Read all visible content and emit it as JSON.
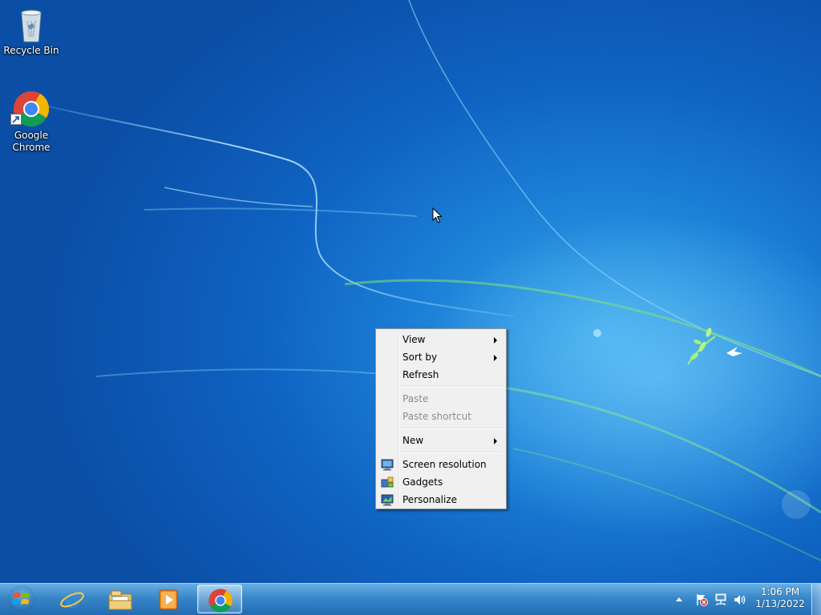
{
  "desktop": {
    "icons": [
      {
        "label": "Recycle Bin",
        "icon": "recycle-bin-icon"
      },
      {
        "label": "Google Chrome",
        "icon": "chrome-icon"
      }
    ]
  },
  "context_menu": {
    "items": [
      {
        "label": "View",
        "submenu": true,
        "enabled": true
      },
      {
        "label": "Sort by",
        "submenu": true,
        "enabled": true
      },
      {
        "label": "Refresh",
        "submenu": false,
        "enabled": true
      },
      {
        "label": "Paste",
        "submenu": false,
        "enabled": false
      },
      {
        "label": "Paste shortcut",
        "submenu": false,
        "enabled": false
      },
      {
        "label": "New",
        "submenu": true,
        "enabled": true
      },
      {
        "label": "Screen resolution",
        "submenu": false,
        "enabled": true,
        "icon": "screen-resolution-icon"
      },
      {
        "label": "Gadgets",
        "submenu": false,
        "enabled": true,
        "icon": "gadgets-icon"
      },
      {
        "label": "Personalize",
        "submenu": false,
        "enabled": true,
        "icon": "personalize-icon"
      }
    ]
  },
  "taskbar": {
    "pinned": [
      {
        "icon": "internet-explorer-icon"
      },
      {
        "icon": "windows-explorer-icon"
      },
      {
        "icon": "media-player-icon"
      },
      {
        "icon": "chrome-icon",
        "active": true
      }
    ],
    "tray": {
      "icons": [
        "show-hidden-icons",
        "action-center-flag-icon",
        "network-icon",
        "volume-icon"
      ]
    },
    "clock": {
      "time": "1:06 PM",
      "date": "1/13/2022"
    }
  },
  "colors": {
    "desktop_blue": "#1b7fd6",
    "menu_bg": "#f0f0f0",
    "disabled_text": "#8d8d8d"
  }
}
